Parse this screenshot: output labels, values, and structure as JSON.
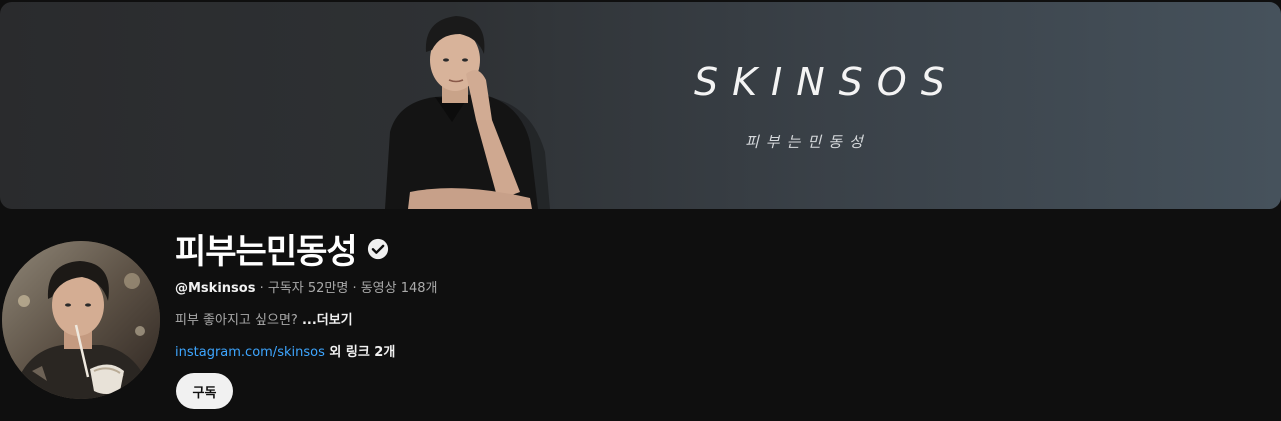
{
  "banner": {
    "title": "SKINSOS",
    "subtitle": "피부는민동성"
  },
  "channel": {
    "name": "피부는민동성",
    "verified_icon": "verified-check-icon",
    "handle": "@Mskinsos",
    "stats": " · 구독자 52만명 · 동영상 148개",
    "description": "피부 좋아지고 싶으면? ",
    "more_label": "...더보기",
    "link_text": "instagram.com/skinsos",
    "other_links": " 외 링크 2개",
    "subscribe_label": "구독"
  },
  "colors": {
    "background": "#0f0f0f",
    "link": "#3ea6ff",
    "subscribe_bg": "#f1f1f1"
  }
}
